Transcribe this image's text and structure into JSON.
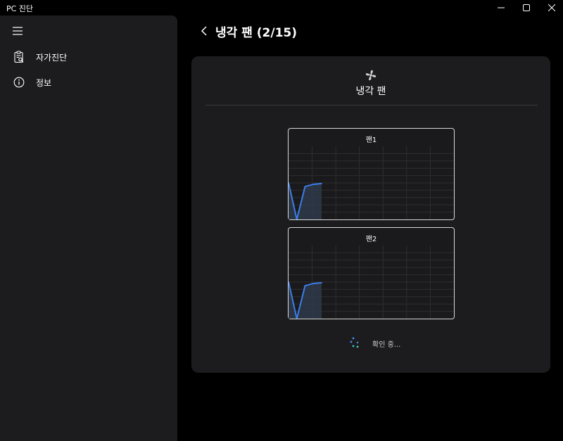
{
  "window": {
    "title": "PC 진단",
    "controls": {
      "minimize": "minimize-icon",
      "maximize": "maximize-icon",
      "close": "close-icon"
    }
  },
  "sidebar": {
    "menu_icon": "hamburger-icon",
    "items": [
      {
        "label": "자가진단",
        "icon": "clipboard-search-icon"
      },
      {
        "label": "정보",
        "icon": "info-icon"
      }
    ]
  },
  "header": {
    "back_icon": "chevron-left-icon",
    "title": "냉각 팬 (2/15)"
  },
  "card": {
    "icon": "fan-icon",
    "title": "냉각 팬",
    "status_text": "확인 중..."
  },
  "colors": {
    "accent_line": "#3b7de8",
    "area_fill": "#2e3a4a",
    "panel": "#1c1c1e",
    "background": "#000000"
  },
  "chart_data": [
    {
      "type": "area",
      "title": "팬1",
      "x": [
        0,
        1,
        2,
        3,
        4
      ],
      "values": [
        50,
        0,
        45,
        48,
        49
      ],
      "ylim": [
        0,
        100
      ],
      "xlim": [
        0,
        20
      ],
      "grid": true
    },
    {
      "type": "area",
      "title": "팬2",
      "x": [
        0,
        1,
        2,
        3,
        4
      ],
      "values": [
        50,
        0,
        45,
        48,
        49
      ],
      "ylim": [
        0,
        100
      ],
      "xlim": [
        0,
        20
      ],
      "grid": true
    }
  ]
}
